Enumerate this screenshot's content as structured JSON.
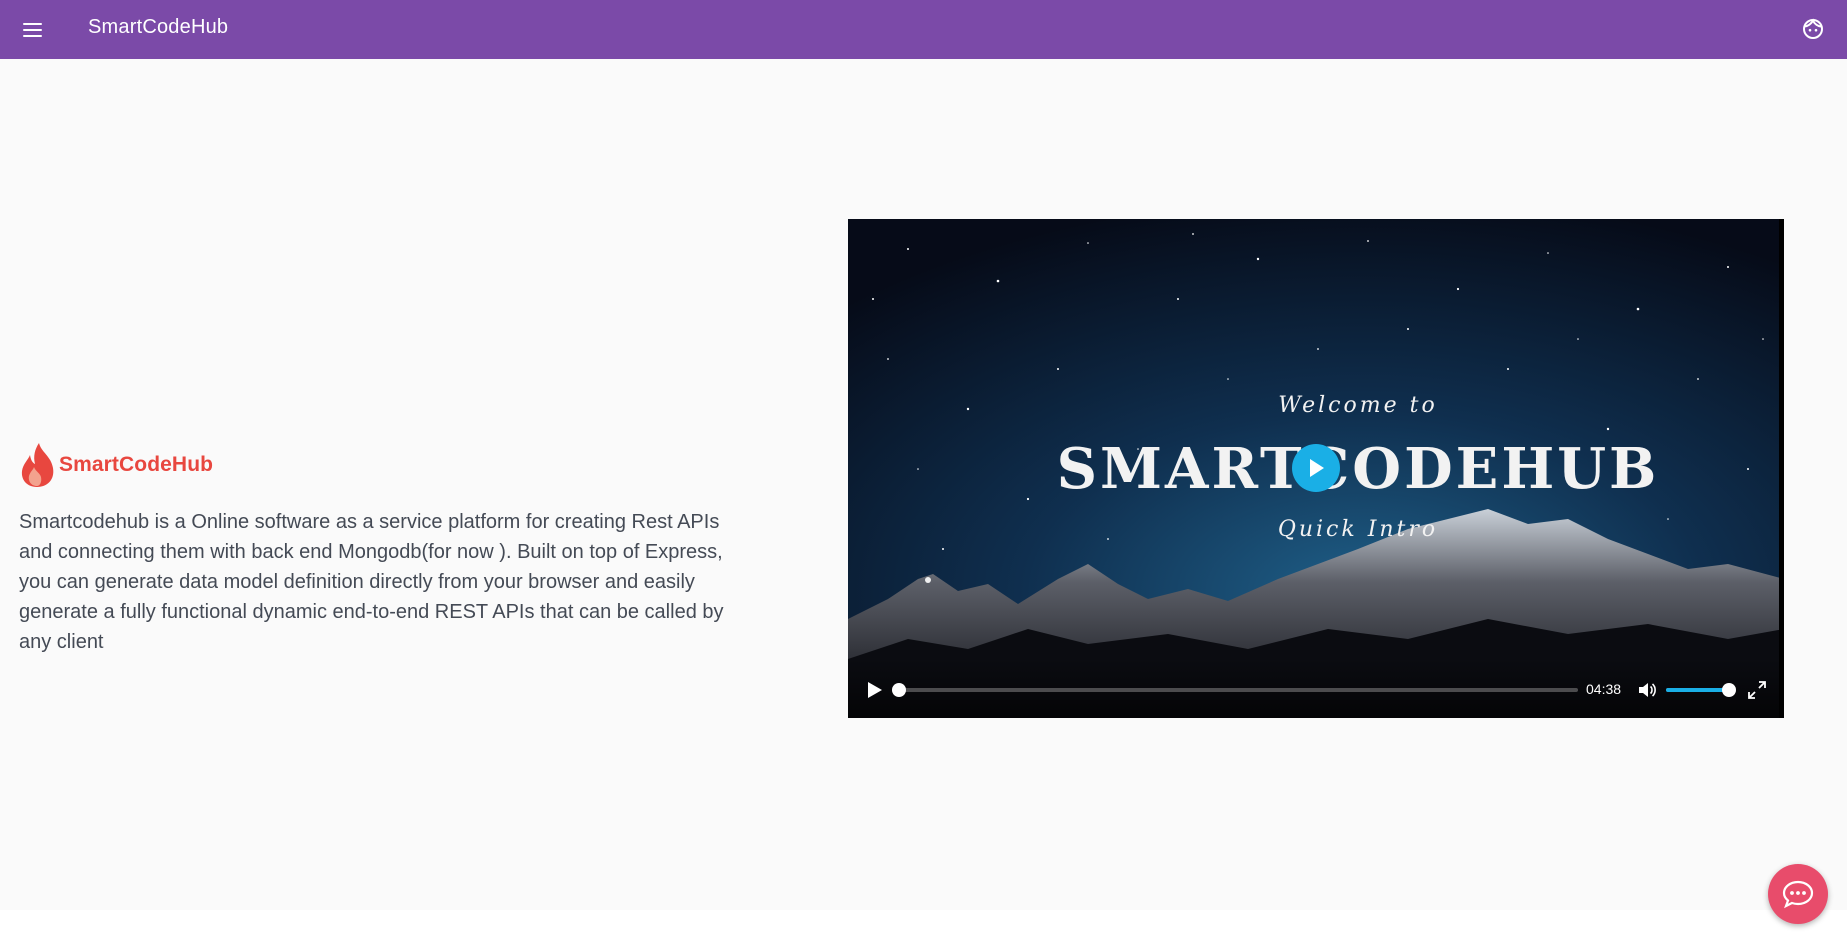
{
  "header": {
    "title": "SmartCodeHub",
    "menu_icon": "menu-icon",
    "account_icon": "account-face-icon",
    "bar_color": "#7b4aa8"
  },
  "hero": {
    "logo_text": "SmartCodeHub",
    "logo_icon": "flame-icon",
    "logo_color": "#e8473f",
    "description": "Smartcodehub is a Online software as a service platform for creating Rest APIs and connecting them with back end Mongodb(for now ). Built on top of Express, you can generate data model definition directly from your browser and easily generate a fully functional dynamic end-to-end REST APIs that can be called by any client"
  },
  "video": {
    "poster_line1": "Welcome to",
    "poster_line2": "SMARTCODEHUB",
    "poster_line3": "Quick Intro",
    "duration": "04:38",
    "progress": 0,
    "volume": 0.92,
    "accent_color": "#1aafe6",
    "icons": {
      "big_play": "play-circle-icon",
      "play": "play-icon",
      "mute": "volume-icon",
      "fullscreen": "fullscreen-icon"
    }
  },
  "chat": {
    "icon": "chat-bubble-icon",
    "color": "#e84c6b"
  }
}
